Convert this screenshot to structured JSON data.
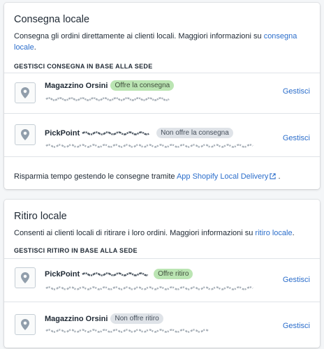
{
  "local_delivery": {
    "title": "Consegna locale",
    "description": "Consegna gli ordini direttamente ai clienti locali. Maggiori informazioni su ",
    "description_link": "consegna locale",
    "description_end": ".",
    "section_heading": "GESTISCI CONSEGNA IN BASE ALLA SEDE",
    "locations": [
      {
        "name": "Magazzino Orsini",
        "status": "Offre la consegna",
        "status_color": "#bbe5b3",
        "action": "Gestisci"
      },
      {
        "name": "PickPoint",
        "status": "Non offre la consegna",
        "status_color": "#dfe3e8",
        "action": "Gestisci"
      }
    ],
    "footer_text": "Risparmia tempo gestendo le consegne tramite ",
    "footer_link": "App Shopify Local Delivery",
    "footer_end": "."
  },
  "local_pickup": {
    "title": "Ritiro locale",
    "description": "Consenti ai clienti locali di ritirare i loro ordini. Maggiori informazioni su ",
    "description_link": "ritiro locale",
    "description_end": ".",
    "section_heading": "GESTISCI RITIRO IN BASE ALLA SEDE",
    "locations": [
      {
        "name": "PickPoint",
        "status": "Offre ritiro",
        "status_color": "#bbe5b3",
        "action": "Gestisci"
      },
      {
        "name": "Magazzino Orsini",
        "status": "Non offre ritiro",
        "status_color": "#dfe3e8",
        "action": "Gestisci"
      }
    ]
  },
  "icons": {
    "location": "location-pin-icon",
    "external": "external-link-icon"
  },
  "colors": {
    "link": "#2c6ecb",
    "background": "#f4f6f8"
  }
}
